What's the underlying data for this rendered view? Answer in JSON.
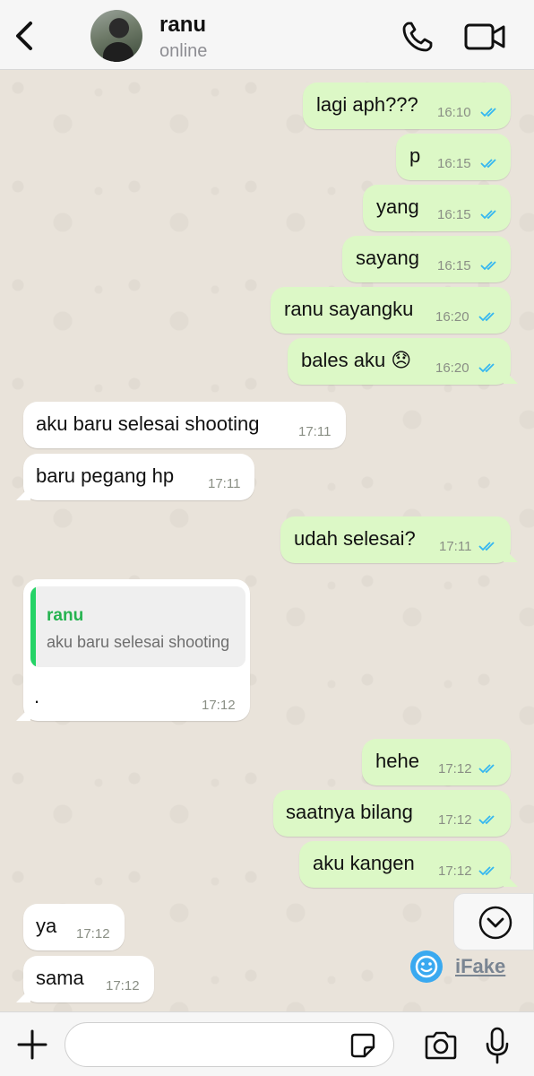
{
  "header": {
    "back_icon": "chevron-left-icon",
    "contact_name": "ranu",
    "status": "online",
    "call_icon": "phone-icon",
    "video_icon": "video-camera-icon"
  },
  "colors": {
    "outgoing_bubble": "#dcf8c6",
    "incoming_bubble": "#ffffff",
    "read_ticks": "#34b7f1",
    "quote_bar": "#25d366"
  },
  "messages": [
    {
      "dir": "out",
      "text": "lagi aph???",
      "time": "16:10",
      "read": true
    },
    {
      "dir": "out",
      "text": "p",
      "time": "16:15",
      "read": true
    },
    {
      "dir": "out",
      "text": "yang",
      "time": "16:15",
      "read": true
    },
    {
      "dir": "out",
      "text": "sayang",
      "time": "16:15",
      "read": true
    },
    {
      "dir": "out",
      "text": "ranu sayangku",
      "time": "16:20",
      "read": true
    },
    {
      "dir": "out",
      "text": "bales aku 😞",
      "time": "16:20",
      "read": true
    },
    {
      "dir": "in",
      "text": "aku baru selesai shooting",
      "time": "17:11"
    },
    {
      "dir": "in",
      "text": "baru pegang hp",
      "time": "17:11"
    },
    {
      "dir": "out",
      "text": "udah selesai?",
      "time": "17:11",
      "read": true
    },
    {
      "dir": "in",
      "text": ".",
      "time": "17:12",
      "reply_to": {
        "name": "ranu",
        "text": "aku baru selesai shooting"
      }
    },
    {
      "dir": "out",
      "text": "hehe",
      "time": "17:12",
      "read": true
    },
    {
      "dir": "out",
      "text": "saatnya bilang",
      "time": "17:12",
      "read": true
    },
    {
      "dir": "out",
      "text": "aku kangen",
      "time": "17:12",
      "read": true
    },
    {
      "dir": "in",
      "text": "ya",
      "time": "17:12"
    },
    {
      "dir": "in",
      "text": "sama",
      "time": "17:12"
    }
  ],
  "scroll_down_icon": "chevron-down-circle-icon",
  "watermark": {
    "icon": "smiley-icon",
    "text": "iFake"
  },
  "input_bar": {
    "plus_icon": "plus-icon",
    "placeholder": "",
    "sticker_icon": "sticker-icon",
    "camera_icon": "camera-icon",
    "mic_icon": "microphone-icon"
  }
}
